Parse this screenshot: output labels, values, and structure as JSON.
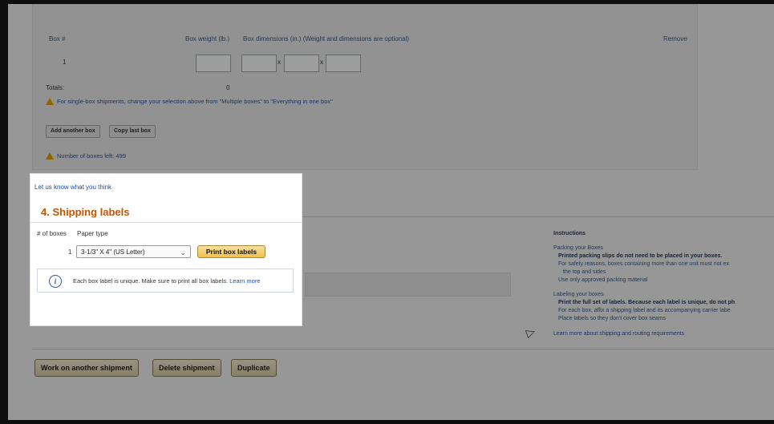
{
  "boxes_panel": {
    "headers": {
      "box_num": "Box #",
      "box_weight": "Box weight (lb.)",
      "box_dimensions": "Box dimensions (in.) (Weight and dimensions are optional)",
      "remove": "Remove"
    },
    "row_number": "1",
    "dim_separator": "x",
    "totals_label": "Totals:",
    "totals_value": "0",
    "single_box_warning": "For single-box shipments, change your selection above from \"Multiple boxes\" to \"Everything in one box\"",
    "add_box_label": "Add another box",
    "copy_box_label": "Copy last box",
    "boxes_left": "Number of boxes left: 499"
  },
  "instructions": {
    "title": "Instructions",
    "packing_title": "Packing your Boxes",
    "packing_items": [
      "Printed packing slips do not need to be placed in your boxes.",
      "For safety reasons, boxes containing more than one unit must not ex",
      "the top and sides",
      "Use only approved packing material"
    ],
    "labeling_title": "Labeling your boxes",
    "labeling_items": [
      "Print the full set of labels. Because each label is unique, do not ph",
      "For each box, affix a shipping label and its accompanying carrier labe",
      "Place labels so they don't cover box seams"
    ],
    "learn_more": "Learn more about shipping and routing requirements"
  },
  "bottom_buttons": {
    "work_another": "Work on another shipment",
    "delete": "Delete shipment",
    "duplicate": "Duplicate"
  },
  "modal": {
    "feedback_link": "Let us know what you think",
    "title": "4. Shipping labels",
    "col_boxes": "# of boxes",
    "col_paper": "Paper type",
    "row_count": "1",
    "paper_selected": "3-1/3\" X 4\" (US Letter)",
    "print_button": "Print box labels",
    "info_text": "Each box label is unique. Make sure to print all box labels.",
    "info_link": "Learn more"
  },
  "colors": {
    "accent_orange": "#c45500",
    "print_button": "#f0c14b",
    "link_blue": "#1c4ea0"
  }
}
